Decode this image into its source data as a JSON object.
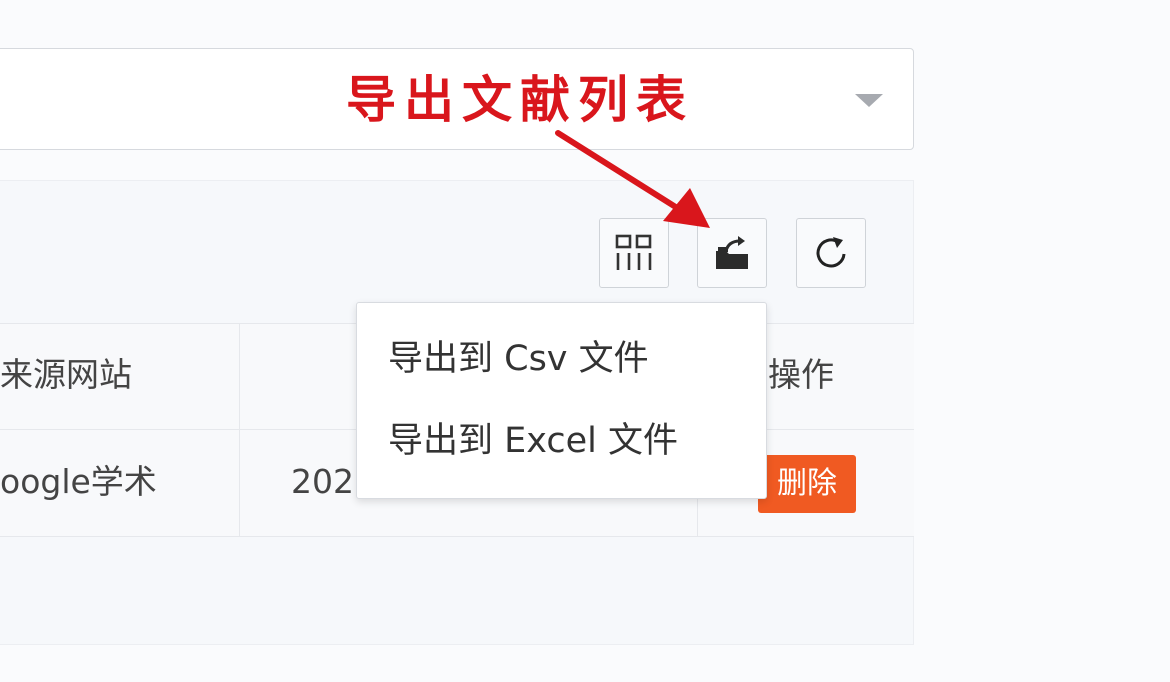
{
  "annotation": {
    "text": "导出文献列表",
    "color": "#d9161c"
  },
  "toolbar": {
    "buttons": [
      {
        "name": "columns",
        "icon": "columns-grid-icon"
      },
      {
        "name": "export",
        "icon": "export-folder-icon"
      },
      {
        "name": "refresh",
        "icon": "refresh-icon"
      }
    ]
  },
  "table": {
    "headers": [
      "来源网站",
      "",
      "操作"
    ],
    "rows": [
      {
        "source": "oogle学术",
        "year": "202",
        "action": "删除"
      }
    ]
  },
  "export_menu": {
    "items": [
      "导出到 Csv 文件",
      "导出到 Excel 文件"
    ]
  },
  "colors": {
    "delete_button": "#f05a22",
    "annotation": "#d9161c"
  }
}
